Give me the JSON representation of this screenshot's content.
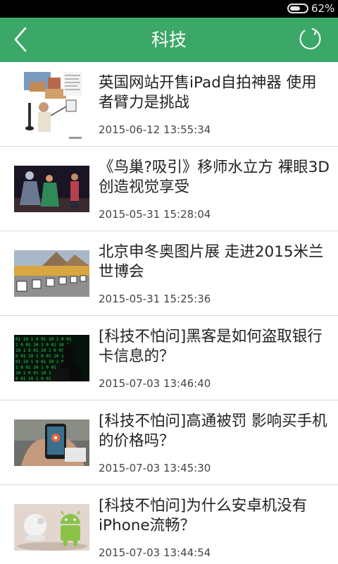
{
  "status_bar": {
    "battery_text": "62%",
    "battery_level": 0.62
  },
  "header": {
    "title": "科技",
    "back_icon": "chevron-left-icon",
    "refresh_icon": "refresh-icon",
    "background": "#3ca867"
  },
  "articles": [
    {
      "title": "英国网站开售iPad自拍神器 使用者臂力是挑战",
      "time": "2015-06-12 13:55:34",
      "image": "ipad-selfie-thumbnail"
    },
    {
      "title": "《鸟巢?吸引》移师水立方 裸眼3D创造视觉享受",
      "time": "2015-05-31 15:28:04",
      "image": "stage-performance-thumbnail"
    },
    {
      "title": "北京申冬奥图片展 走进2015米兰世博会",
      "time": "2015-05-31 15:25:36",
      "image": "expo-exhibition-thumbnail"
    },
    {
      "title": "[科技不怕问]黑客是如何盗取银行卡信息的？",
      "time": "2015-07-03 13:46:40",
      "image": "hacker-thumbnail"
    },
    {
      "title": "[科技不怕问]高通被罚 影响买手机的价格吗？",
      "time": "2015-07-03 13:45:30",
      "image": "phone-in-hand-thumbnail"
    },
    {
      "title": "[科技不怕问]为什么安卓机没有iPhone流畅？",
      "time": "2015-07-03 13:44:54",
      "image": "android-vs-apple-thumbnail"
    }
  ]
}
